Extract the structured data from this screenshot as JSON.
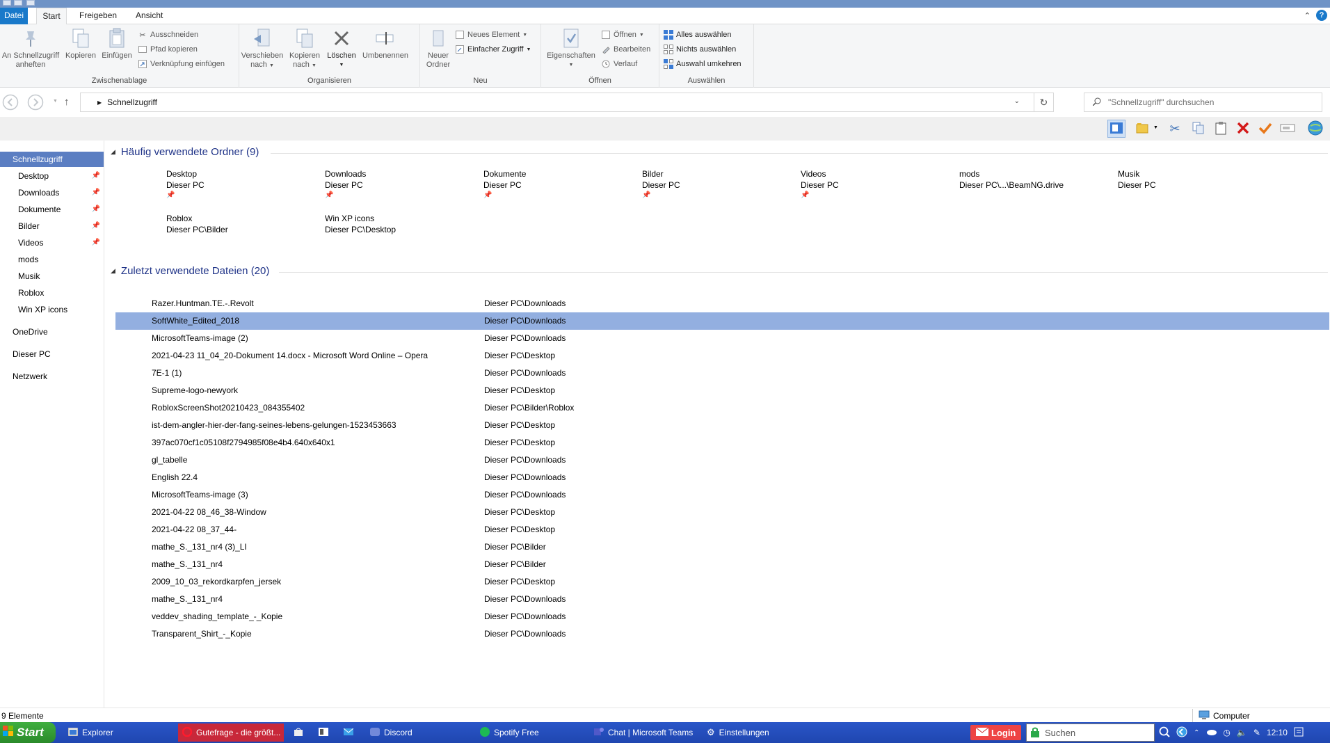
{
  "ribbon_tabs": {
    "datei": "Datei",
    "start": "Start",
    "freigeben": "Freigeben",
    "ansicht": "Ansicht"
  },
  "clipboard": {
    "pin_label_1": "An Schnellzugriff",
    "pin_label_2": "anheften",
    "copy": "Kopieren",
    "paste": "Einfügen",
    "cut": "Ausschneiden",
    "copy_path": "Pfad kopieren",
    "paste_shortcut": "Verknüpfung einfügen",
    "group": "Zwischenablage"
  },
  "organize": {
    "move_1": "Verschieben",
    "move_2": "nach",
    "copyto_1": "Kopieren",
    "copyto_2": "nach",
    "delete": "Löschen",
    "rename": "Umbenennen",
    "group": "Organisieren"
  },
  "new": {
    "folder_1": "Neuer",
    "folder_2": "Ordner",
    "new_item": "Neues Element",
    "easy_access": "Einfacher Zugriff",
    "group": "Neu"
  },
  "open": {
    "properties": "Eigenschaften",
    "open": "Öffnen",
    "edit": "Bearbeiten",
    "history": "Verlauf",
    "group": "Öffnen"
  },
  "select": {
    "all": "Alles auswählen",
    "none": "Nichts auswählen",
    "invert": "Auswahl umkehren",
    "group": "Auswählen"
  },
  "address": {
    "crumb": "Schnellzugriff"
  },
  "search": {
    "placeholder": "\"Schnellzugriff\" durchsuchen"
  },
  "sidebar": {
    "quick": "Schnellzugriff",
    "items": [
      "Desktop",
      "Downloads",
      "Dokumente",
      "Bilder",
      "Videos",
      "mods",
      "Musik",
      "Roblox",
      "Win XP icons"
    ],
    "onedrive": "OneDrive",
    "thispc": "Dieser PC",
    "network": "Netzwerk"
  },
  "frequent": {
    "title": "Häufig verwendete Ordner (9)",
    "folders": [
      {
        "name": "Desktop",
        "path": "Dieser PC"
      },
      {
        "name": "Downloads",
        "path": "Dieser PC"
      },
      {
        "name": "Dokumente",
        "path": "Dieser PC"
      },
      {
        "name": "Bilder",
        "path": "Dieser PC"
      },
      {
        "name": "Videos",
        "path": "Dieser PC"
      },
      {
        "name": "mods",
        "path": "Dieser PC\\...\\BeamNG.drive"
      },
      {
        "name": "Musik",
        "path": "Dieser PC"
      },
      {
        "name": "Roblox",
        "path": "Dieser PC\\Bilder"
      },
      {
        "name": "Win XP icons",
        "path": "Dieser PC\\Desktop"
      }
    ]
  },
  "recent": {
    "title": "Zuletzt verwendete Dateien (20)",
    "files": [
      {
        "name": "Razer.Huntman.TE.-.Revolt",
        "path": "Dieser PC\\Downloads"
      },
      {
        "name": "SoftWhite_Edited_2018",
        "path": "Dieser PC\\Downloads"
      },
      {
        "name": "MicrosoftTeams-image (2)",
        "path": "Dieser PC\\Downloads"
      },
      {
        "name": "2021-04-23 11_04_20-Dokument 14.docx - Microsoft Word Online – Opera",
        "path": "Dieser PC\\Desktop"
      },
      {
        "name": "7E-1 (1)",
        "path": "Dieser PC\\Downloads"
      },
      {
        "name": "Supreme-logo-newyork",
        "path": "Dieser PC\\Desktop"
      },
      {
        "name": "RobloxScreenShot20210423_084355402",
        "path": "Dieser PC\\Bilder\\Roblox"
      },
      {
        "name": "ist-dem-angler-hier-der-fang-seines-lebens-gelungen-1523453663",
        "path": "Dieser PC\\Desktop"
      },
      {
        "name": "397ac070cf1c05108f2794985f08e4b4.640x640x1",
        "path": "Dieser PC\\Desktop"
      },
      {
        "name": "gl_tabelle",
        "path": "Dieser PC\\Downloads"
      },
      {
        "name": "English 22.4",
        "path": "Dieser PC\\Downloads"
      },
      {
        "name": "MicrosoftTeams-image (3)",
        "path": "Dieser PC\\Downloads"
      },
      {
        "name": "2021-04-22 08_46_38-Window",
        "path": "Dieser PC\\Desktop"
      },
      {
        "name": "2021-04-22 08_37_44-",
        "path": "Dieser PC\\Desktop"
      },
      {
        "name": "mathe_S._131_nr4 (3)_LI",
        "path": "Dieser PC\\Bilder"
      },
      {
        "name": "mathe_S._131_nr4",
        "path": "Dieser PC\\Bilder"
      },
      {
        "name": "2009_10_03_rekordkarpfen_jersek",
        "path": "Dieser PC\\Desktop"
      },
      {
        "name": "mathe_S._131_nr4",
        "path": "Dieser PC\\Downloads"
      },
      {
        "name": "veddev_shading_template_-_Kopie",
        "path": "Dieser PC\\Downloads"
      },
      {
        "name": "Transparent_Shirt_-_Kopie",
        "path": "Dieser PC\\Downloads"
      }
    ]
  },
  "status": {
    "count": "9 Elemente",
    "computer": "Computer"
  },
  "taskbar": {
    "start": "Start",
    "explorer": "Explorer",
    "gutefrage": "Gutefrage - die größt...",
    "discord": "Discord",
    "spotify": "Spotify Free",
    "teams": "Chat | Microsoft Teams",
    "settings": "Einstellungen",
    "login": "Login",
    "search": "Suchen",
    "time": "12:10"
  },
  "colors": {
    "accent": "#1979ca",
    "selection": "#93afe0",
    "taskbar": "#2a56c8",
    "start": "#3fae3f"
  }
}
